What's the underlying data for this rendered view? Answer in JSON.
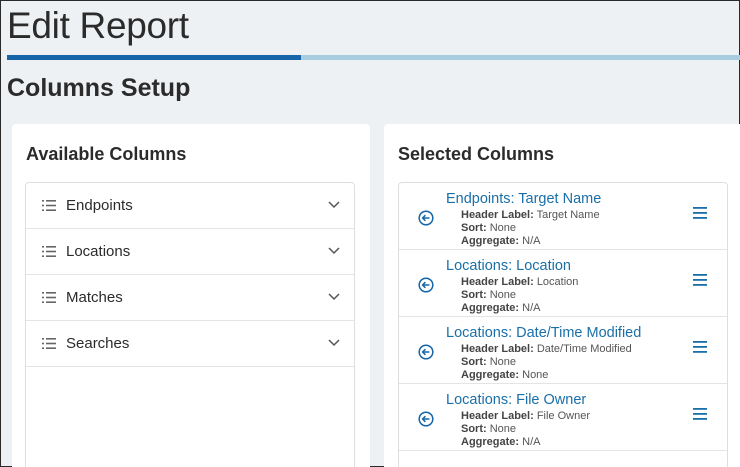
{
  "page": {
    "title": "Edit Report",
    "section_title": "Columns Setup"
  },
  "progress": {
    "fraction": 0.4
  },
  "available": {
    "title": "Available Columns",
    "items": [
      {
        "label": "Endpoints"
      },
      {
        "label": "Locations"
      },
      {
        "label": "Matches"
      },
      {
        "label": "Searches"
      }
    ]
  },
  "selected": {
    "title": "Selected Columns",
    "items": [
      {
        "title": "Endpoints: Target Name",
        "header_label_key": "Header Label:",
        "header_label": "Target Name",
        "sort_key": "Sort:",
        "sort": "None",
        "aggregate_key": "Aggregate:",
        "aggregate": "N/A"
      },
      {
        "title": "Locations: Location",
        "header_label_key": "Header Label:",
        "header_label": "Location",
        "sort_key": "Sort:",
        "sort": "None",
        "aggregate_key": "Aggregate:",
        "aggregate": "N/A"
      },
      {
        "title": "Locations: Date/Time Modified",
        "header_label_key": "Header Label:",
        "header_label": "Date/Time Modified",
        "sort_key": "Sort:",
        "sort": "None",
        "aggregate_key": "Aggregate:",
        "aggregate": "None"
      },
      {
        "title": "Locations: File Owner",
        "header_label_key": "Header Label:",
        "header_label": "File Owner",
        "sort_key": "Sort:",
        "sort": "None",
        "aggregate_key": "Aggregate:",
        "aggregate": "N/A"
      }
    ]
  },
  "colors": {
    "accent": "#1565a8",
    "progress_track": "#a9cde0",
    "link": "#1a6fa8"
  },
  "icons": {
    "list": "list-icon",
    "expand": "chevron-down-icon",
    "remove": "arrow-left-circle-icon",
    "drag": "drag-handle-icon"
  }
}
